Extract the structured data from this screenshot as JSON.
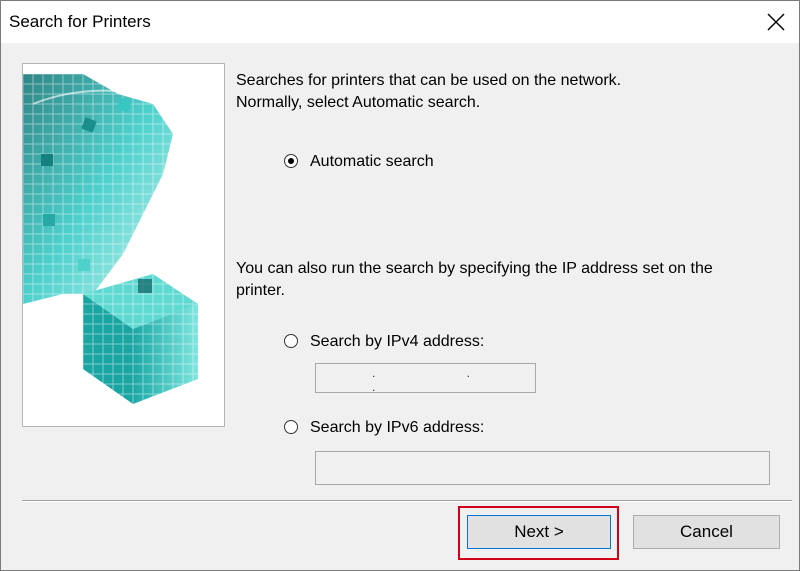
{
  "window": {
    "title": "Search for Printers"
  },
  "intro": {
    "line1": "Searches for printers that can be used on the network.",
    "line2": "Normally, select Automatic search."
  },
  "options": {
    "automatic": {
      "label": "Automatic search",
      "selected": true
    },
    "ipv4": {
      "label": "Search by IPv4 address:",
      "selected": false,
      "value": ". . ."
    },
    "ipv6": {
      "label": "Search by IPv6 address:",
      "selected": false,
      "value": ""
    }
  },
  "hint": {
    "line1": "You can also run the search by specifying the IP address set on the",
    "line2": "printer."
  },
  "buttons": {
    "next": "Next >",
    "cancel": "Cancel"
  },
  "icons": {
    "close": "close-icon",
    "art": "cube-graphic"
  },
  "colors": {
    "accent": "#0078d7",
    "highlight": "#d0021b",
    "art_teal": "#2fc4c0"
  }
}
